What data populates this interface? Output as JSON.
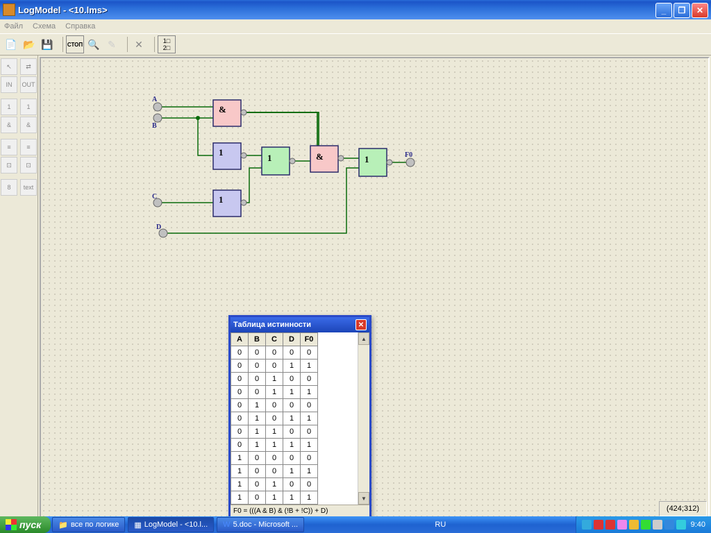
{
  "window": {
    "title": "LogModel - <10.lms>"
  },
  "menu": {
    "items": [
      "Файл",
      "Схема",
      "Справка"
    ]
  },
  "toolbar": {
    "new": "new",
    "open": "open",
    "save": "save",
    "stop": "СТОП",
    "find": "find",
    "edit": "edit",
    "delete": "✕",
    "list": "list"
  },
  "leftpanel": {
    "arrow": "↖",
    "move": "⇄",
    "in": "IN",
    "out": "OUT",
    "n1": "1",
    "n1b": "1",
    "and": "&",
    "andb": "&",
    "g1": "≡",
    "g2": "≡",
    "g3": "⊡",
    "g4": "⊡",
    "seg": "8",
    "text": "text"
  },
  "circuit": {
    "inputs": {
      "A": "A",
      "B": "B",
      "C": "C",
      "D": "D"
    },
    "gates": {
      "and1": "&",
      "not1": "1",
      "not2": "1",
      "or1": "1",
      "and2": "&",
      "or2": "1"
    },
    "output": "F0"
  },
  "truth": {
    "title": "Таблица истинности",
    "headers": [
      "A",
      "B",
      "C",
      "D",
      "F0"
    ],
    "rows": [
      [
        0,
        0,
        0,
        0,
        0
      ],
      [
        0,
        0,
        0,
        1,
        1
      ],
      [
        0,
        0,
        1,
        0,
        0
      ],
      [
        0,
        0,
        1,
        1,
        1
      ],
      [
        0,
        1,
        0,
        0,
        0
      ],
      [
        0,
        1,
        0,
        1,
        1
      ],
      [
        0,
        1,
        1,
        0,
        0
      ],
      [
        0,
        1,
        1,
        1,
        1
      ],
      [
        1,
        0,
        0,
        0,
        0
      ],
      [
        1,
        0,
        0,
        1,
        1
      ],
      [
        1,
        0,
        1,
        0,
        0
      ],
      [
        1,
        0,
        1,
        1,
        1
      ]
    ],
    "formula": "F0 = (((A & B) & (!B + !C)) + D)"
  },
  "status": {
    "coords": "(424;312)"
  },
  "taskbar": {
    "start": "пуск",
    "btn1": "все по логике",
    "btn2": "LogModel - <10.l...",
    "btn3": "5.doc - Microsoft ...",
    "lang": "RU",
    "clock": "9:40"
  }
}
